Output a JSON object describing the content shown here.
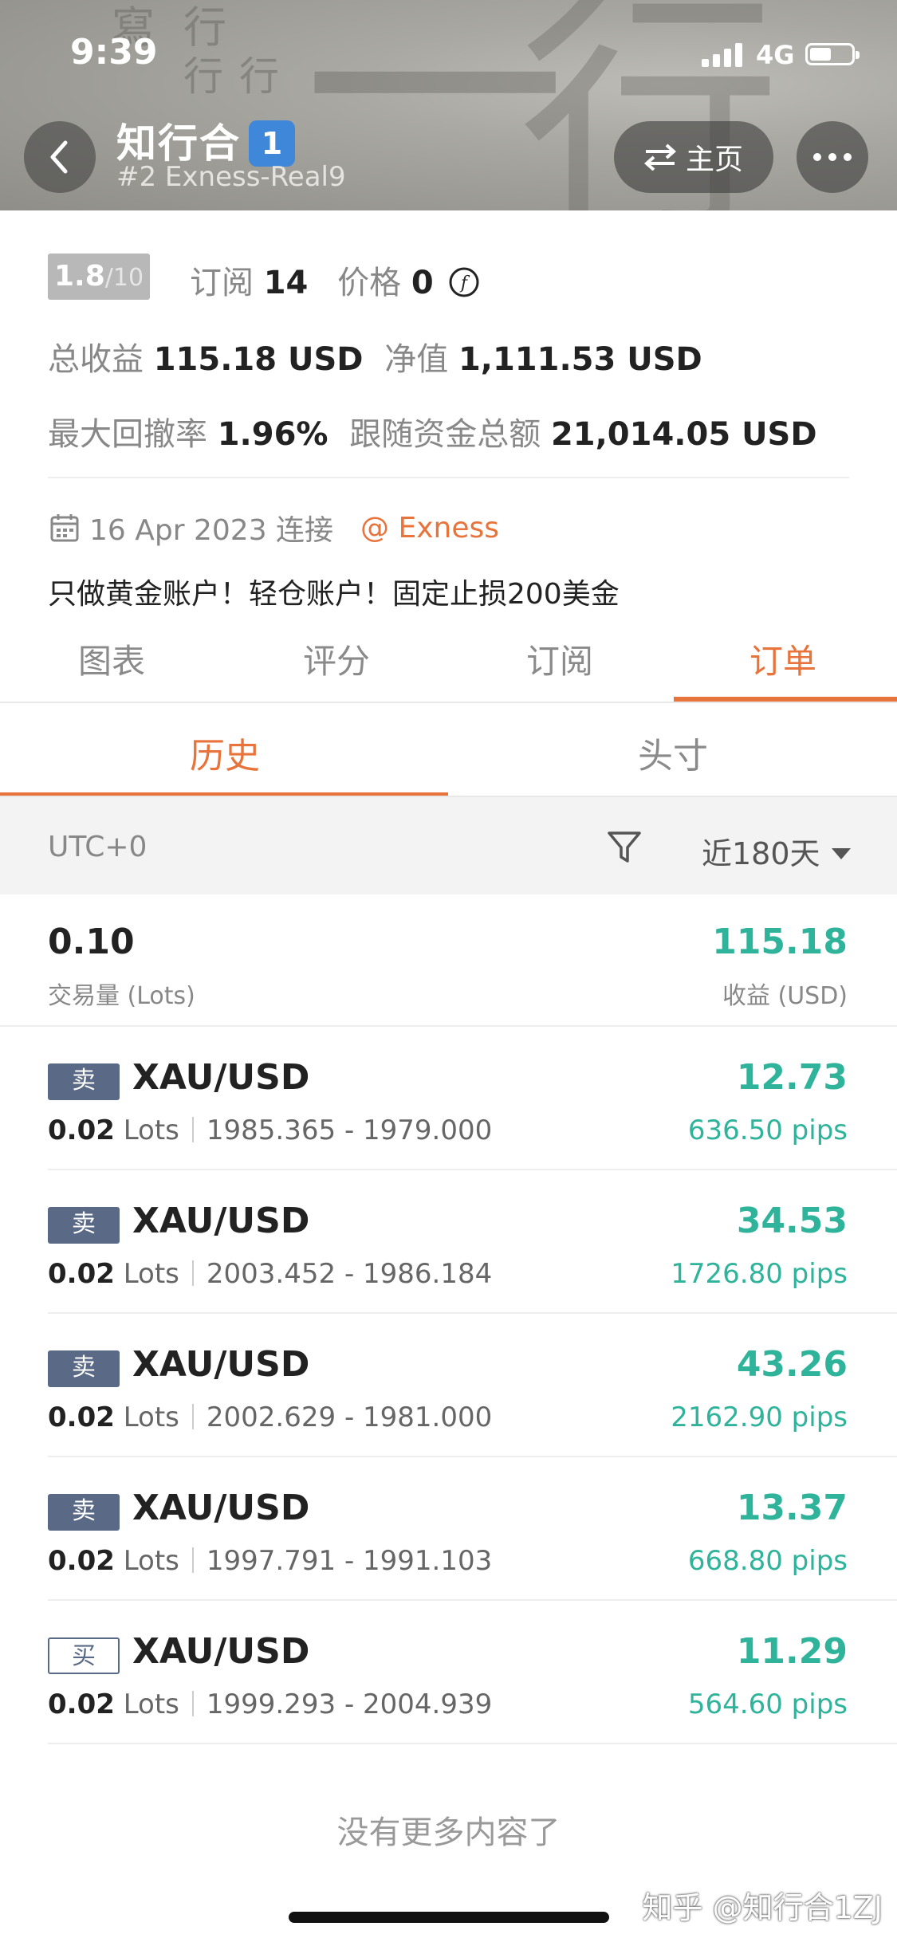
{
  "status_bar": {
    "time": "9:39",
    "network": "4G"
  },
  "header": {
    "title": "知行合",
    "title_badge": "1",
    "subtitle": "#2 Exness-Real9",
    "home_label": "主页",
    "background_text": [
      "寫",
      "行",
      "行",
      "行",
      "一",
      "行"
    ]
  },
  "stats": {
    "rating": "1.8",
    "rating_max": "/10",
    "subscribe_label": "订阅",
    "subscribe_count": "14",
    "price_label": "价格",
    "price_value": "0",
    "total_profit_label": "总收益",
    "total_profit_value": "115.18 USD",
    "equity_label": "净值",
    "equity_value": "1,111.53 USD",
    "max_drawdown_label": "最大回撤率",
    "max_drawdown_value": "1.96%",
    "follow_total_label": "跟随资金总额",
    "follow_total_value": "21,014.05 USD"
  },
  "meta": {
    "connected": "16 Apr 2023 连接",
    "broker": "@ Exness"
  },
  "description": "只做黄金账户！轻仓账户！固定止损200美金",
  "tabs": [
    "图表",
    "评分",
    "订阅",
    "订单"
  ],
  "active_tab": "订单",
  "subtabs": [
    "历史",
    "头寸"
  ],
  "filter": {
    "timezone": "UTC+0",
    "range": "近180天"
  },
  "summary": {
    "volume": "0.10",
    "volume_label": "交易量 (Lots)",
    "profit": "115.18",
    "profit_label": "收益 (USD)"
  },
  "trades": [
    {
      "side": "卖",
      "symbol": "XAU/USD",
      "lots": "0.02",
      "lots_unit": "Lots",
      "range": "1985.365 - 1979.000",
      "profit": "12.73",
      "pips": "636.50 pips"
    },
    {
      "side": "卖",
      "symbol": "XAU/USD",
      "lots": "0.02",
      "lots_unit": "Lots",
      "range": "2003.452 - 1986.184",
      "profit": "34.53",
      "pips": "1726.80 pips"
    },
    {
      "side": "卖",
      "symbol": "XAU/USD",
      "lots": "0.02",
      "lots_unit": "Lots",
      "range": "2002.629 - 1981.000",
      "profit": "43.26",
      "pips": "2162.90 pips"
    },
    {
      "side": "卖",
      "symbol": "XAU/USD",
      "lots": "0.02",
      "lots_unit": "Lots",
      "range": "1997.791 - 1991.103",
      "profit": "13.37",
      "pips": "668.80 pips"
    },
    {
      "side": "买",
      "symbol": "XAU/USD",
      "lots": "0.02",
      "lots_unit": "Lots",
      "range": "1999.293 - 2004.939",
      "profit": "11.29",
      "pips": "564.60 pips"
    }
  ],
  "footer": {
    "no_more": "没有更多内容了",
    "watermark": "知乎 @知行合1ZJ"
  },
  "colors": {
    "accent": "#e8743b",
    "profit": "#2fb39b",
    "sell_tag": "#5a6a86"
  }
}
